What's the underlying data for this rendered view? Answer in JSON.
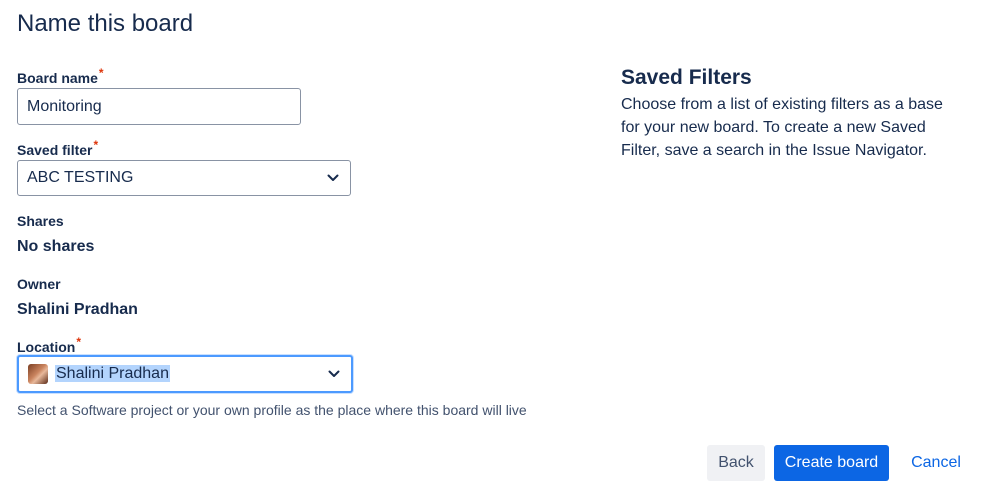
{
  "dialog": {
    "title": "Name this board"
  },
  "form": {
    "board_name": {
      "label": "Board name",
      "required_mark": "*",
      "value": "Monitoring"
    },
    "saved_filter": {
      "label": "Saved filter",
      "required_mark": "*",
      "selected": "ABC TESTING",
      "icon": "chevron-down-icon"
    },
    "shares": {
      "label": "Shares",
      "value": "No shares"
    },
    "owner": {
      "label": "Owner",
      "value": "Shalini Pradhan"
    },
    "location": {
      "label": "Location",
      "required_mark": "*",
      "selected": "Shalini Pradhan",
      "icon": "chevron-down-icon",
      "avatar": "user-avatar",
      "help": "Select a Software project or your own profile as the place where this board will live"
    }
  },
  "sidebar": {
    "title": "Saved Filters",
    "description": "Choose from a list of existing filters as a base for your new board. To create a new Saved Filter, save a search in the Issue Navigator."
  },
  "actions": {
    "back": "Back",
    "create": "Create board",
    "cancel": "Cancel"
  },
  "colors": {
    "primary": "#0c66e4",
    "required": "#de350b",
    "focus_ring": "#4c9aff",
    "text": "#172b4d"
  }
}
